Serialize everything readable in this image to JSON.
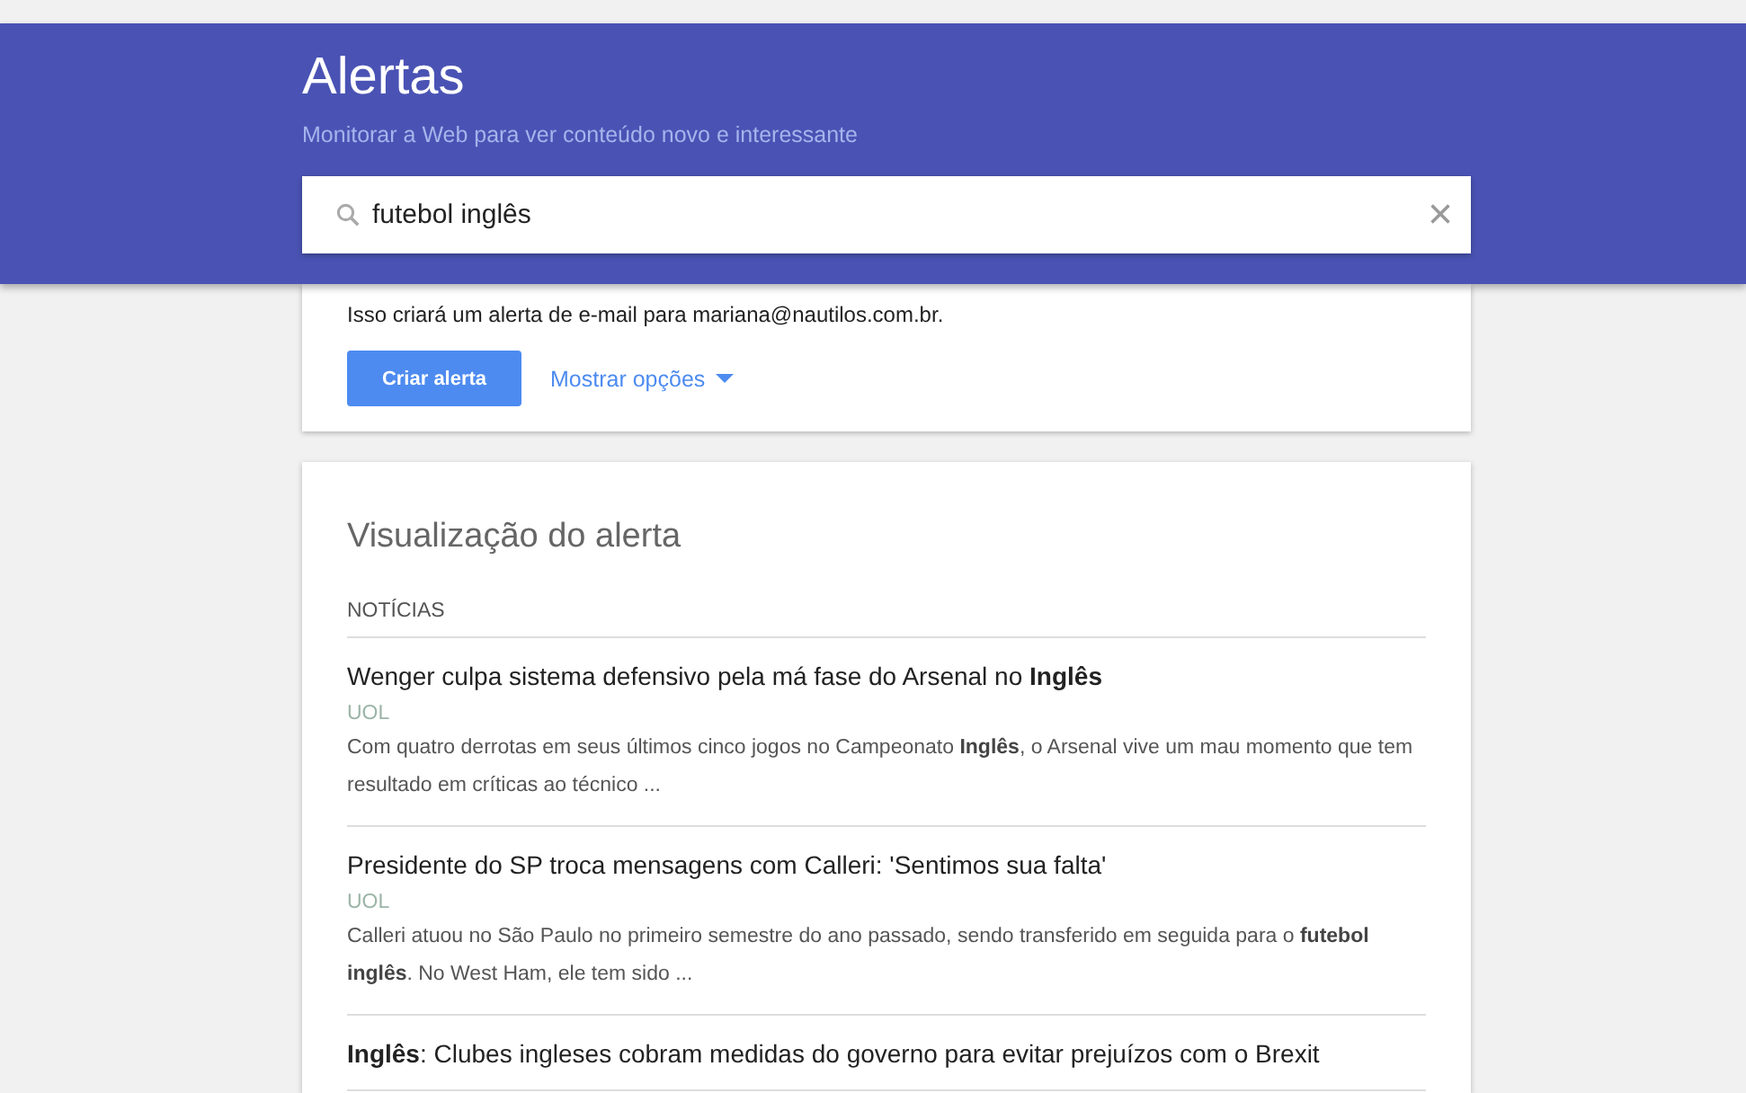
{
  "header": {
    "title": "Alertas",
    "subtitle": "Monitorar a Web para ver conteúdo novo e interessante"
  },
  "search": {
    "value": "futebol inglês",
    "clear": "×"
  },
  "create_card": {
    "notice": "Isso criará um alerta de e-mail para mariana@nautilos.com.br.",
    "create_button": "Criar alerta",
    "options_link": "Mostrar opções"
  },
  "preview": {
    "title": "Visualização do alerta",
    "section": "NOTÍCIAS",
    "results": [
      {
        "title": "Wenger culpa sistema defensivo pela má fase do Arsenal no **Inglês**",
        "source": "UOL",
        "snippet": "Com quatro derrotas em seus últimos cinco jogos no Campeonato **Inglês**, o Arsenal vive um mau momento que tem resultado em críticas ao técnico ..."
      },
      {
        "title": "Presidente do SP troca mensagens com Calleri: 'Sentimos sua falta'",
        "source": "UOL",
        "snippet": "Calleri atuou no São Paulo no primeiro semestre do ano passado, sendo transferido em seguida para o **futebol inglês**. No West Ham, ele tem sido ..."
      },
      {
        "title": "**Inglês**: Clubes ingleses cobram medidas do governo para evitar prejuízos com o Brexit"
      }
    ]
  }
}
